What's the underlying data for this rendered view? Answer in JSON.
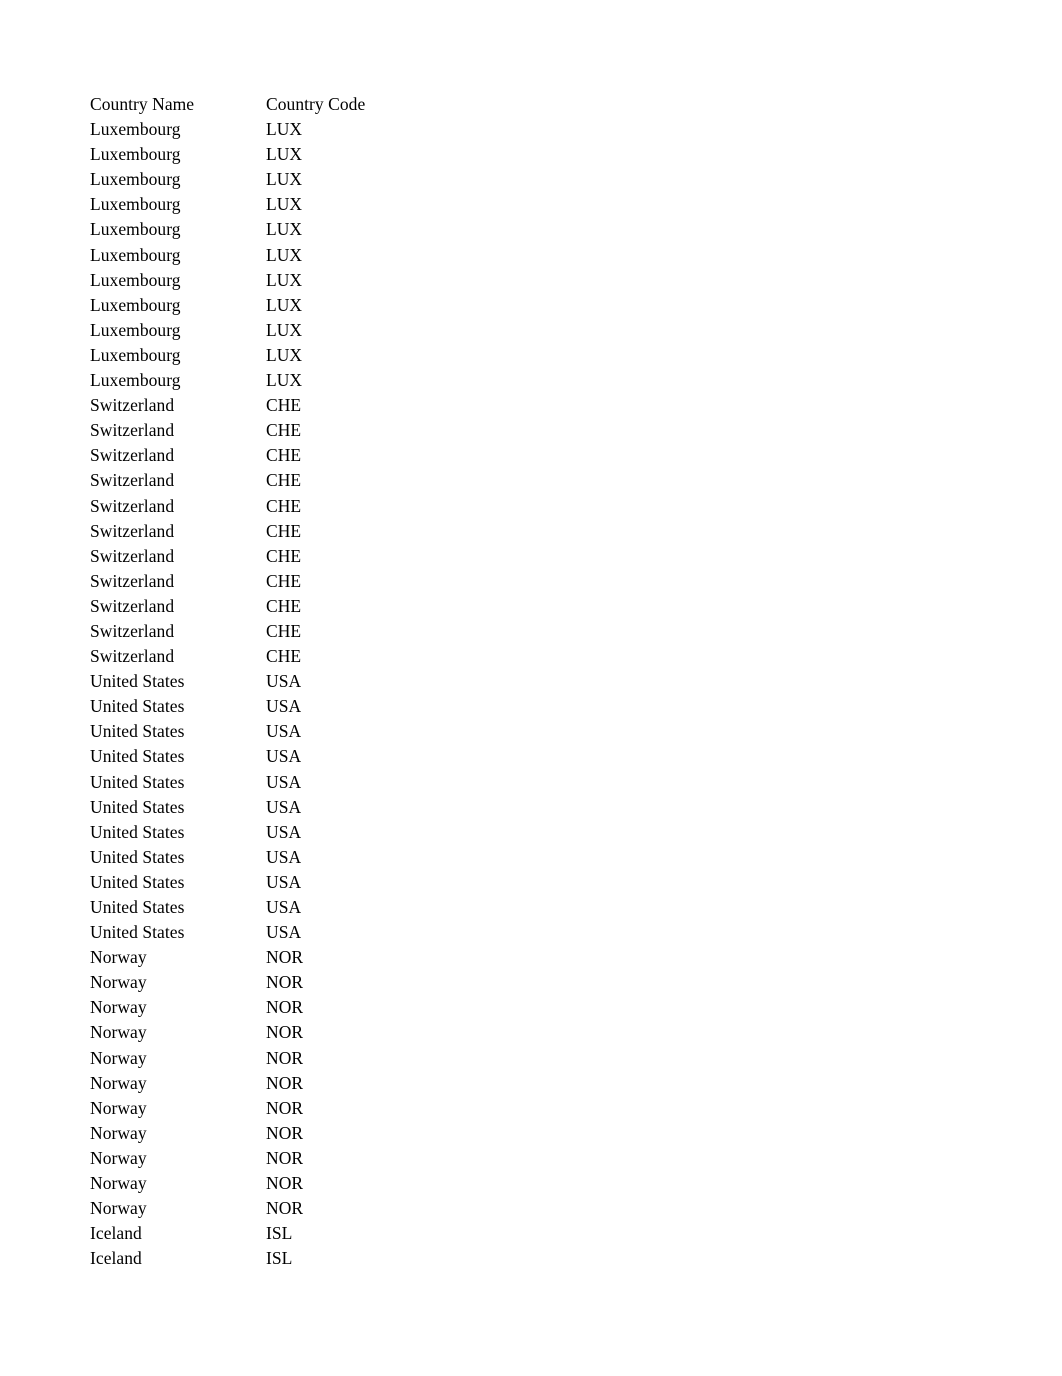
{
  "document": {
    "table": {
      "columns": [
        "Country Name",
        "Country Code"
      ],
      "rows": [
        [
          "Luxembourg",
          "LUX"
        ],
        [
          "Luxembourg",
          "LUX"
        ],
        [
          "Luxembourg",
          "LUX"
        ],
        [
          "Luxembourg",
          "LUX"
        ],
        [
          "Luxembourg",
          "LUX"
        ],
        [
          "Luxembourg",
          "LUX"
        ],
        [
          "Luxembourg",
          "LUX"
        ],
        [
          "Luxembourg",
          "LUX"
        ],
        [
          "Luxembourg",
          "LUX"
        ],
        [
          "Luxembourg",
          "LUX"
        ],
        [
          "Luxembourg",
          "LUX"
        ],
        [
          "Switzerland",
          "CHE"
        ],
        [
          "Switzerland",
          "CHE"
        ],
        [
          "Switzerland",
          "CHE"
        ],
        [
          "Switzerland",
          "CHE"
        ],
        [
          "Switzerland",
          "CHE"
        ],
        [
          "Switzerland",
          "CHE"
        ],
        [
          "Switzerland",
          "CHE"
        ],
        [
          "Switzerland",
          "CHE"
        ],
        [
          "Switzerland",
          "CHE"
        ],
        [
          "Switzerland",
          "CHE"
        ],
        [
          "Switzerland",
          "CHE"
        ],
        [
          "United States",
          "USA"
        ],
        [
          "United States",
          "USA"
        ],
        [
          "United States",
          "USA"
        ],
        [
          "United States",
          "USA"
        ],
        [
          "United States",
          "USA"
        ],
        [
          "United States",
          "USA"
        ],
        [
          "United States",
          "USA"
        ],
        [
          "United States",
          "USA"
        ],
        [
          "United States",
          "USA"
        ],
        [
          "United States",
          "USA"
        ],
        [
          "United States",
          "USA"
        ],
        [
          "Norway",
          "NOR"
        ],
        [
          "Norway",
          "NOR"
        ],
        [
          "Norway",
          "NOR"
        ],
        [
          "Norway",
          "NOR"
        ],
        [
          "Norway",
          "NOR"
        ],
        [
          "Norway",
          "NOR"
        ],
        [
          "Norway",
          "NOR"
        ],
        [
          "Norway",
          "NOR"
        ],
        [
          "Norway",
          "NOR"
        ],
        [
          "Norway",
          "NOR"
        ],
        [
          "Norway",
          "NOR"
        ],
        [
          "Iceland",
          "ISL"
        ],
        [
          "Iceland",
          "ISL"
        ]
      ]
    }
  }
}
